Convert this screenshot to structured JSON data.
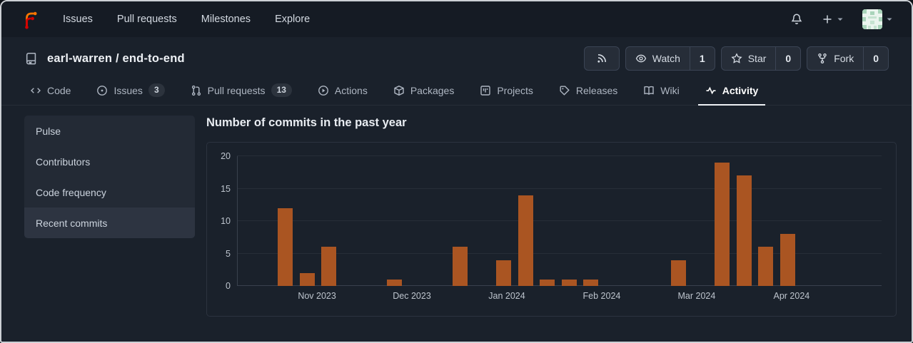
{
  "navbar": {
    "items": [
      {
        "label": "Issues"
      },
      {
        "label": "Pull requests"
      },
      {
        "label": "Milestones"
      },
      {
        "label": "Explore"
      }
    ]
  },
  "repo_header": {
    "owner_repo": "earl-warren / end-to-end",
    "actions": {
      "watch": {
        "label": "Watch",
        "count": "1"
      },
      "star": {
        "label": "Star",
        "count": "0"
      },
      "fork": {
        "label": "Fork",
        "count": "0"
      }
    }
  },
  "tabs": [
    {
      "label": "Code"
    },
    {
      "label": "Issues",
      "badge": "3"
    },
    {
      "label": "Pull requests",
      "badge": "13"
    },
    {
      "label": "Actions"
    },
    {
      "label": "Packages"
    },
    {
      "label": "Projects"
    },
    {
      "label": "Releases"
    },
    {
      "label": "Wiki"
    },
    {
      "label": "Activity",
      "active": true
    }
  ],
  "sidebar": {
    "items": [
      {
        "label": "Pulse"
      },
      {
        "label": "Contributors"
      },
      {
        "label": "Code frequency"
      },
      {
        "label": "Recent commits",
        "active": true
      }
    ]
  },
  "main": {
    "title": "Number of commits in the past year"
  },
  "chart_data": {
    "type": "bar",
    "title": "Number of commits in the past year",
    "ylabel": "",
    "xlabel": "",
    "ylim": [
      0,
      20
    ],
    "y_ticks": [
      0,
      5,
      10,
      15,
      20
    ],
    "x_tick_labels": [
      "Nov 2023",
      "Dec 2023",
      "Jan 2024",
      "Feb 2024",
      "Mar 2024",
      "Apr 2024"
    ],
    "bar_color": "#aa5522",
    "grid": true,
    "weekly_values": [
      12,
      2,
      6,
      0,
      0,
      1,
      0,
      0,
      6,
      0,
      4,
      14,
      1,
      1,
      1,
      0,
      0,
      0,
      4,
      0,
      19,
      17,
      6,
      8
    ]
  },
  "colors": {
    "bar": "#aa5522",
    "active_tab_underline": "#eef1f5"
  }
}
